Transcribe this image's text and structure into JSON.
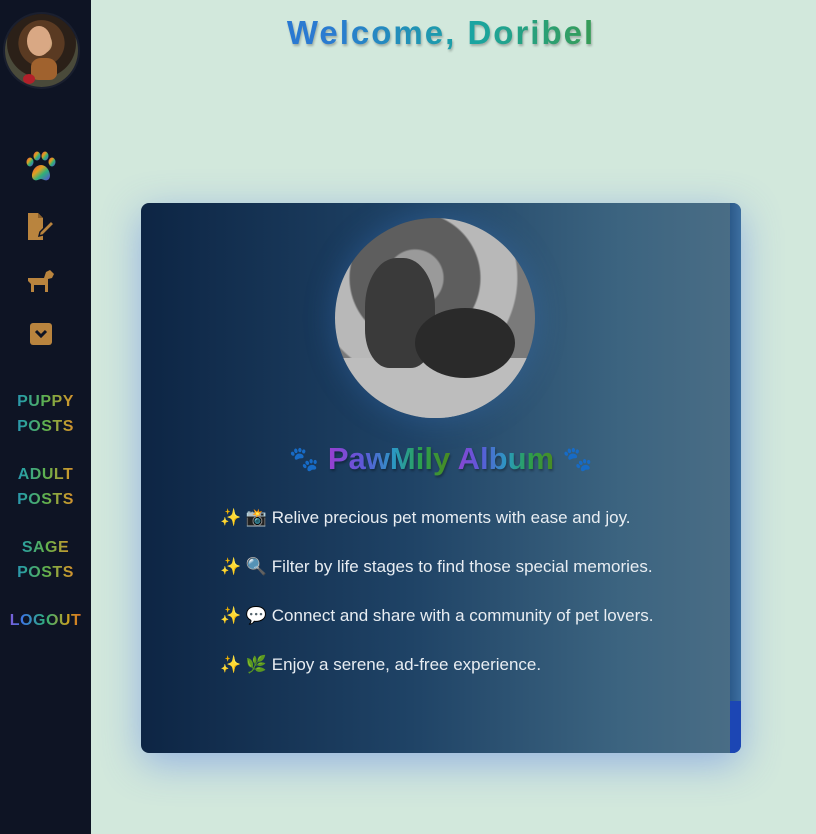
{
  "header": {
    "welcome": "Welcome, Doribel"
  },
  "sidebar": {
    "icons": [
      "paw-icon",
      "edit-document-icon",
      "dog-icon",
      "archive-icon"
    ],
    "items": [
      {
        "line1": "PUPPY",
        "line2": "POSTS"
      },
      {
        "line1": "ADULT",
        "line2": "POSTS"
      },
      {
        "line1": "SAGE",
        "line2": "POSTS"
      }
    ],
    "logout": "LOGOUT"
  },
  "card": {
    "paw_left": "🐾",
    "title_part1": "PawMily",
    "title_part2": " Album",
    "paw_right": "🐾",
    "features": [
      "✨ 📸 Relive precious pet moments with ease and joy.",
      "✨ 🔍 Filter by life stages to find those special memories.",
      "✨ 💬 Connect and share with a community of pet lovers.",
      "✨ 🌿 Enjoy a serene, ad-free experience."
    ]
  },
  "colors": {
    "sidebar_bg": "#0e1424",
    "page_bg": "#d2e8dc",
    "icon_gold": "#b9843e",
    "card_gradient_start": "#0d2544",
    "card_gradient_end": "#4b6e86"
  }
}
